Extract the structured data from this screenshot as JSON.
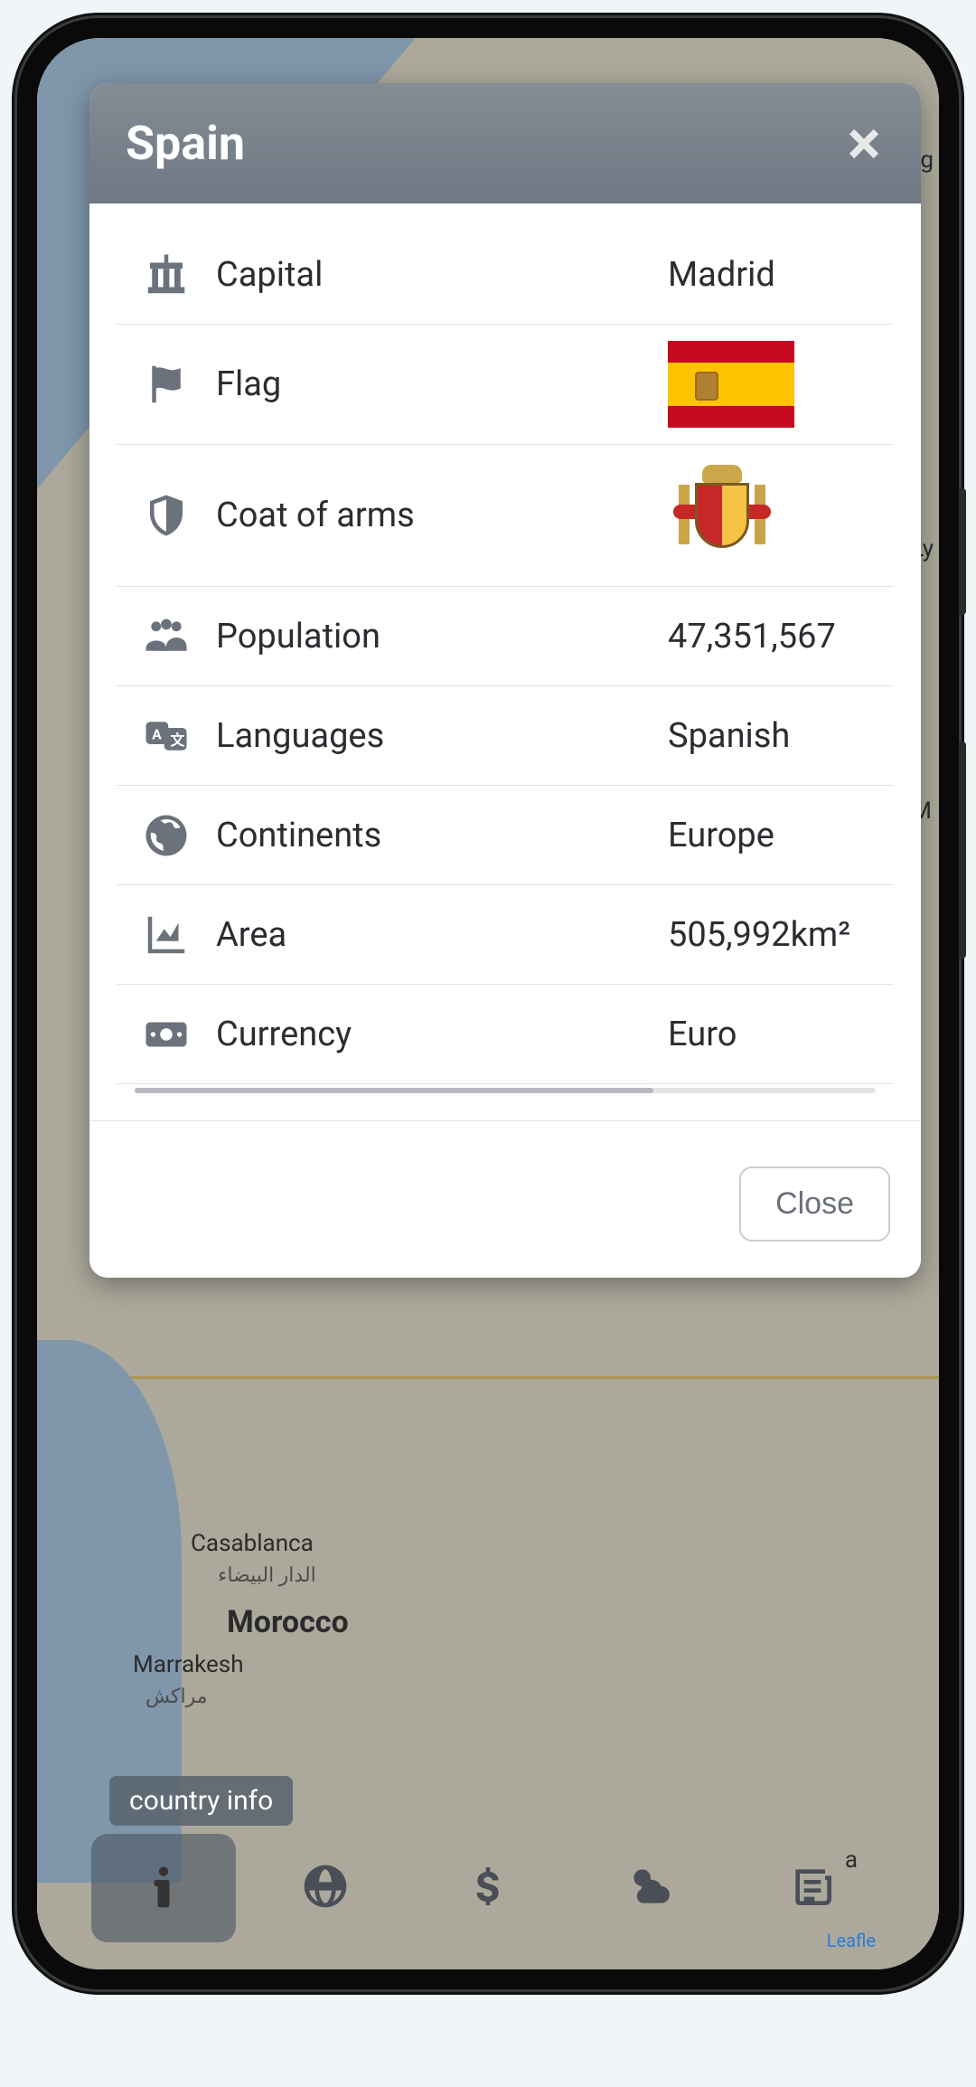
{
  "modal": {
    "title": "Spain",
    "close_button": "Close",
    "rows": {
      "capital": {
        "label": "Capital",
        "value": "Madrid"
      },
      "flag": {
        "label": "Flag"
      },
      "coat": {
        "label": "Coat of arms"
      },
      "population": {
        "label": "Population",
        "value": "47,351,567"
      },
      "languages": {
        "label": "Languages",
        "value": "Spanish"
      },
      "continents": {
        "label": "Continents",
        "value": "Europe"
      },
      "area": {
        "label": "Area",
        "value": "505,992km²"
      },
      "currency": {
        "label": "Currency",
        "value": "Euro"
      }
    }
  },
  "tooltip": "country info",
  "map": {
    "attribution": "Leafle",
    "labels": {
      "casablanca": "Casablanca",
      "casablanca_ar": "الدار البيضاء",
      "morocco": "Morocco",
      "marrakesh": "Marrakesh",
      "marrakesh_ar": "مراكش",
      "ly": "Ly",
      "lg": "lg",
      "a": "a",
      "m": "M"
    }
  },
  "nav": {
    "items": [
      "info",
      "web",
      "currency",
      "weather",
      "news"
    ]
  }
}
